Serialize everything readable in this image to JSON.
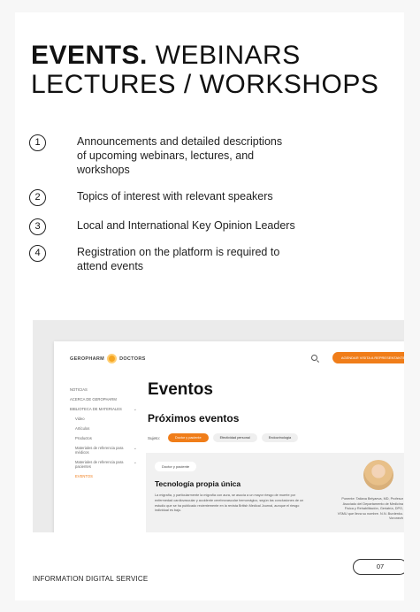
{
  "title": {
    "bold": "EVENTS.",
    "rest_line1": " WEBINARS",
    "line2": "LECTURES / WORKSHOPS"
  },
  "features": [
    {
      "num": "1",
      "text": "Announcements and detailed descriptions of upcoming webinars, lectures, and workshops"
    },
    {
      "num": "2",
      "text": "Topics of interest with relevant speakers"
    },
    {
      "num": "3",
      "text": "Local and International Key Opinion Leaders"
    },
    {
      "num": "4",
      "text": "Registration on the platform is required to attend events"
    }
  ],
  "mock": {
    "brand_left": "GEROPHARM",
    "brand_right": "DOCTORS",
    "cta": "AGENDAR VISITA A REPRESENTANTE",
    "sidebar": [
      {
        "label": "NOTICIAS"
      },
      {
        "label": "ACERCA DE GEROPHARM"
      },
      {
        "label": "BIBLIOTECA DE MATERIALES",
        "chevron": "⌄"
      },
      {
        "label": "Video"
      },
      {
        "label": "Artículos"
      },
      {
        "label": "Productos"
      },
      {
        "label": "Materiales de referencia para médicos",
        "chevron": "⌄"
      },
      {
        "label": "Materiales de referencia para pacientes",
        "chevron": "⌄"
      },
      {
        "label": "EVENTOS"
      }
    ],
    "h1": "Eventos",
    "h2": "Próximos eventos",
    "filter_label": "Sujeto:",
    "filters": [
      "Doctor y paciente",
      "Efectividad personal",
      "Endocrinología"
    ],
    "card": {
      "tag": "Doctor y paciente",
      "title": "Tecnología propia única",
      "body": "La migraña, y particularmente la migraña con aura, se asocia a un mayor riesgo de muerte por enfermedad cardiovascular y accidente cerebrovascular hemorrágico, según las conclusiones de un estudio que se ha publicado recientemente en la revista British Medical Journal, aunque el riesgo individual es bajo.",
      "speaker": "Ponente: Tatiana Belyaeva, MD, Profesor Asociado del Departamento de Medicina Física y Rehabilitación, Geriatría, DPO, VSMU que lleva su nombre. N.N. Burdenko. Voronezh"
    },
    "accent": "#f07d19"
  },
  "footer": {
    "label": "INFORMATION DIGITAL SERVICE",
    "page": "07"
  }
}
